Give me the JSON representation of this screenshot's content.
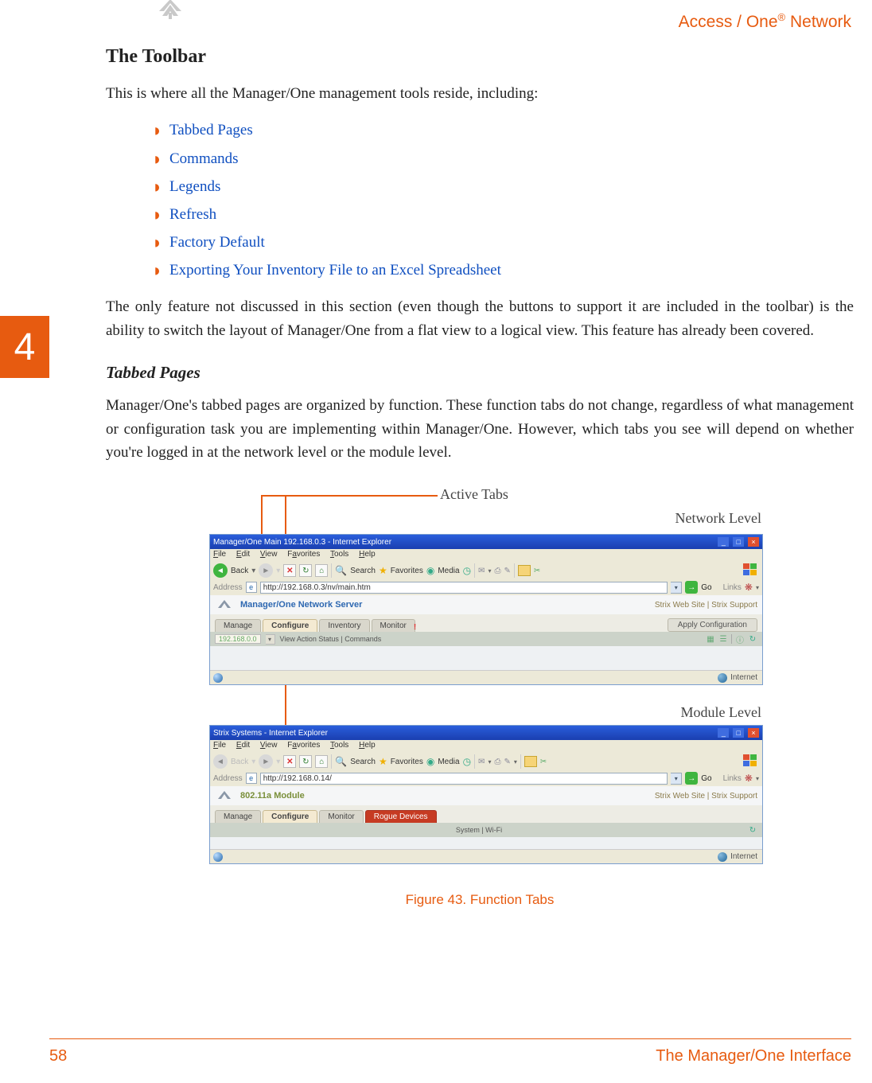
{
  "header": {
    "product_left": "Access / One",
    "product_sup": "®",
    "product_right": " Network"
  },
  "chapter_number": "4",
  "h1": "The Toolbar",
  "intro": "This is where all the Manager/One management tools reside, including:",
  "toolbar_items": {
    "i0": "Tabbed Pages",
    "i1": "Commands",
    "i2": "Legends",
    "i3": "Refresh",
    "i4": "Factory Default",
    "i5": "Exporting Your Inventory File to an Excel Spreadsheet"
  },
  "para_after_list": "The only feature not discussed in this section (even though the buttons to support it are included in the toolbar) is the ability to switch the layout of Manager/One from a flat view to a logical view. This feature has already been covered.",
  "h2": "Tabbed Pages",
  "para_h2": "Manager/One's tabbed pages are organized by function. These function tabs do not change, regardless of what management or configuration task you are implementing within Manager/One. However, which tabs you see will depend on whether you're logged in at the network level or the module level.",
  "figure": {
    "active_tabs_label": "Active Tabs",
    "network_label": "Network Level",
    "module_label": "Module Level",
    "caption": "Figure 43. Function Tabs"
  },
  "browser_network": {
    "title": "Manager/One Main 192.168.0.3 - Internet Explorer",
    "menu": {
      "file": "File",
      "edit": "Edit",
      "view": "View",
      "fav": "Favorites",
      "tools": "Tools",
      "help": "Help"
    },
    "toolbar": {
      "back": "Back",
      "search": "Search",
      "favorites": "Favorites",
      "media": "Media"
    },
    "address_label": "Address",
    "url": "http://192.168.0.3/nv/main.htm",
    "go": "Go",
    "links": "Links",
    "app_title": "Manager/One Network Server",
    "right_links": "Strix Web Site  |  Strix Support",
    "tabs": {
      "manage": "Manage",
      "configure": "Configure",
      "inventory": "Inventory",
      "monitor": "Monitor",
      "apply": "Apply Configuration"
    },
    "ip": "192.168.0.0",
    "subbar": "View Action Status  |  Commands",
    "status": "Internet"
  },
  "browser_module": {
    "title": "Strix Systems - Internet Explorer",
    "menu": {
      "file": "File",
      "edit": "Edit",
      "view": "View",
      "fav": "Favorites",
      "tools": "Tools",
      "help": "Help"
    },
    "toolbar": {
      "back": "Back",
      "search": "Search",
      "favorites": "Favorites",
      "media": "Media"
    },
    "address_label": "Address",
    "url": "http://192.168.0.14/",
    "go": "Go",
    "links": "Links",
    "app_title": "802.11a Module",
    "right_links": "Strix Web Site  |  Strix Support",
    "tabs": {
      "manage": "Manage",
      "configure": "Configure",
      "monitor": "Monitor",
      "rogue": "Rogue Devices"
    },
    "subbar": "System  |  Wi-Fi",
    "status": "Internet"
  },
  "footer": {
    "page": "58",
    "section": "The Manager/One Interface"
  }
}
